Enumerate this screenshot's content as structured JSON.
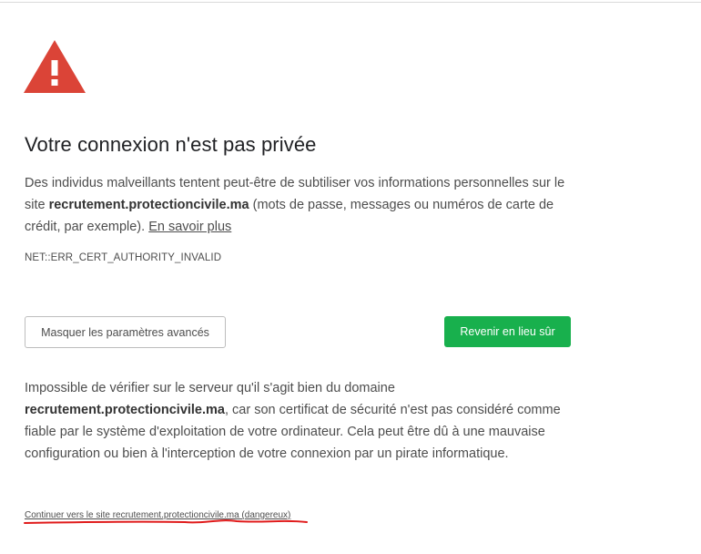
{
  "interstitial": {
    "title": "Votre connexion n'est pas privée",
    "description": {
      "before_host": "Des individus malveillants tentent peut-être de subtiliser vos informations personnelles sur le site ",
      "host": "recrutement.protectioncivile.ma",
      "after_host": " (mots de passe, messages ou numéros de carte de crédit, par exemple). ",
      "learn_more": "En savoir plus"
    },
    "error_code": "NET::ERR_CERT_AUTHORITY_INVALID",
    "buttons": {
      "advanced_label": "Masquer les paramètres avancés",
      "back_label": "Revenir en lieu sûr"
    },
    "details": {
      "before_host": "Impossible de vérifier sur le serveur qu'il s'agit bien du domaine ",
      "host": "recrutement.protectioncivile.ma",
      "after_host": ", car son certificat de sécurité n'est pas considéré comme fiable par le système d'exploitation de votre ordinateur. Cela peut être dû à une mauvaise configuration ou bien à l'interception de votre connexion par un pirate informatique."
    },
    "proceed_link": "Continuer vers le site recrutement.protectioncivile.ma (dangereux)",
    "icon": "warning-triangle-icon",
    "colors": {
      "warning_red": "#db4437",
      "primary_green": "#18b04d",
      "annotation_red": "#e01b1b"
    }
  }
}
